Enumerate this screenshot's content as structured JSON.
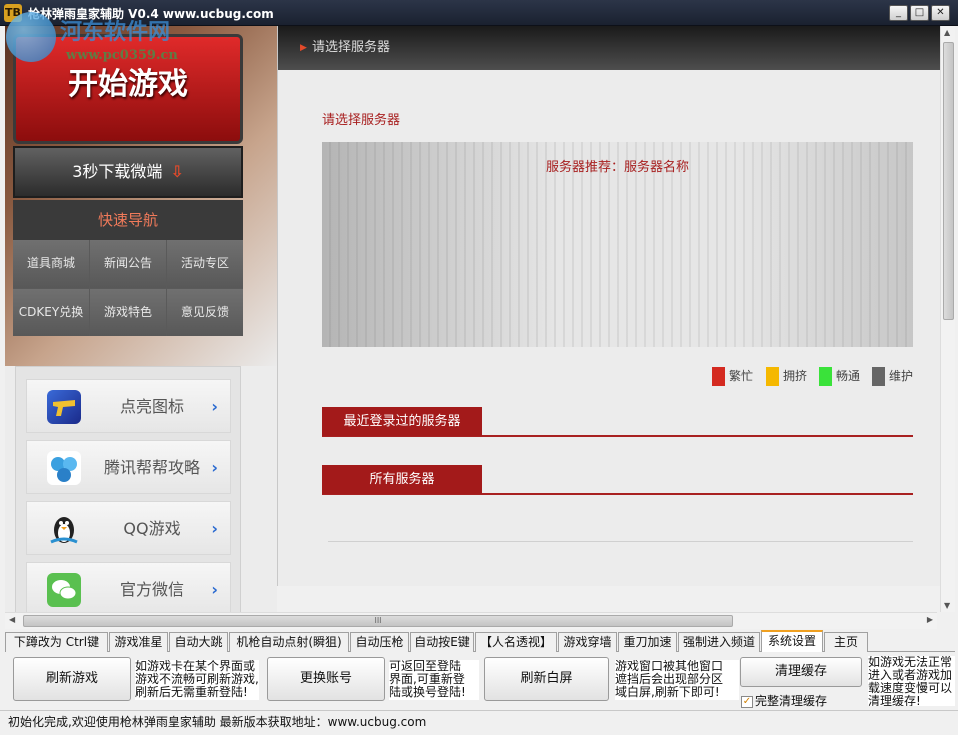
{
  "window": {
    "title": "枪林弹雨皇家辅助 V0.4  www.ucbug.com",
    "logo_text": "TB",
    "minimize": "_",
    "maximize": "□",
    "close": "✕"
  },
  "watermark": {
    "name": "河东软件网",
    "url": "www.pc0359.cn"
  },
  "left": {
    "start_game": "开始游戏",
    "download": "3秒下载微端",
    "download_icon": "⇩",
    "nav_title": "快速导航",
    "nav_items": [
      "道具商城",
      "新闻公告",
      "活动专区",
      "CDKEY兑换",
      "游戏特色",
      "意见反馈"
    ],
    "quick_items": [
      {
        "label": "点亮图标",
        "icon": "gun-icon",
        "color": "#2a5ad0"
      },
      {
        "label": "腾讯帮帮攻略",
        "icon": "bangbang-icon",
        "color": "#3aa0e0"
      },
      {
        "label": "QQ游戏",
        "icon": "penguin-icon",
        "color": "#333333"
      },
      {
        "label": "官方微信",
        "icon": "wechat-icon",
        "color": "#5ac050"
      }
    ],
    "arrow": "›"
  },
  "main": {
    "header": "请选择服务器",
    "select_title": "请选择服务器",
    "recommend": "服务器推荐：服务器名称",
    "legend": [
      {
        "label": "繁忙",
        "color": "#d42a20"
      },
      {
        "label": "拥挤",
        "color": "#f5b800"
      },
      {
        "label": "畅通",
        "color": "#3ae23a"
      },
      {
        "label": "维护",
        "color": "#666666"
      }
    ],
    "recent_section": "最近登录过的服务器",
    "all_section": "所有服务器"
  },
  "scroll": {
    "up": "▲",
    "down": "▼",
    "left": "◀",
    "right": "▶",
    "grip": "III"
  },
  "tabs": [
    {
      "label": "下蹲改为 Ctrl键",
      "active": false
    },
    {
      "label": "游戏准星",
      "active": false
    },
    {
      "label": "自动大跳",
      "active": false
    },
    {
      "label": "机枪自动点射(瞬狙)",
      "active": false
    },
    {
      "label": "自动压枪",
      "active": false
    },
    {
      "label": "自动按E键",
      "active": false
    },
    {
      "label": "【人名透视】",
      "active": false
    },
    {
      "label": "游戏穿墙",
      "active": false
    },
    {
      "label": "重刀加速",
      "active": false
    },
    {
      "label": "强制进入频道",
      "active": false
    },
    {
      "label": "系统设置",
      "active": true
    },
    {
      "label": "主页",
      "active": false
    }
  ],
  "panel": {
    "refresh_game": "刷新游戏",
    "refresh_game_desc": "如游戏卡在某个界面或\n游戏不流畅可刷新游戏,\n刷新后无需重新登陆!",
    "switch_account": "更换账号",
    "switch_account_desc": "可返回至登陆\n界面,可重新登\n陆或换号登陆!",
    "refresh_white": "刷新白屏",
    "refresh_white_desc": "游戏窗口被其他窗口\n遮挡后会出现部分区\n域白屏,刷新下即可!",
    "clear_cache": "清理缓存",
    "clear_cache_desc": "如游戏无法正常\n进入或者游戏加\n载速度变慢可以\n清理缓存!",
    "full_clear_label": "完整清理缓存",
    "full_clear_checked": true
  },
  "status": "初始化完成,欢迎使用枪林弹雨皇家辅助 最新版本获取地址：www.ucbug.com"
}
